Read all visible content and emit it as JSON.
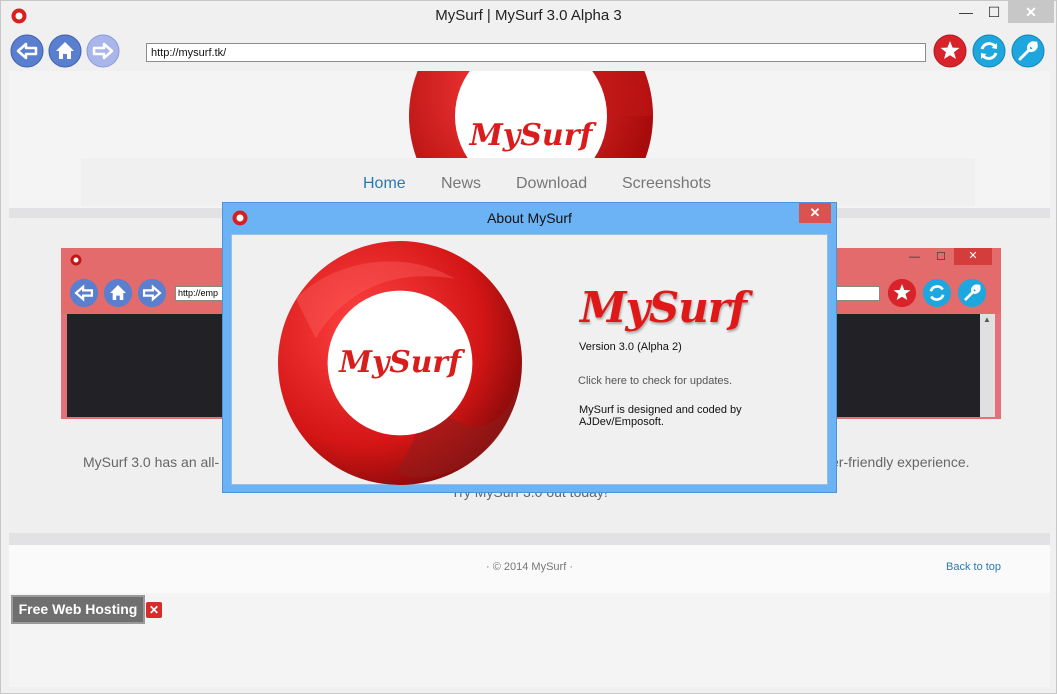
{
  "window": {
    "title": "MySurf | MySurf 3.0 Alpha 3",
    "min_glyph": "—",
    "max_glyph": "☐",
    "close_glyph": "✕"
  },
  "toolbar": {
    "address": "http://mysurf.tk/",
    "icons": [
      "back-arrow-icon",
      "home-icon",
      "forward-arrow-icon",
      "star-icon",
      "refresh-icon",
      "wrench-icon"
    ],
    "colors": {
      "nav_blue": "#5b7fcf",
      "forward_disabled": "#a9b6ea",
      "star_red": "#d8232a",
      "refresh_cyan": "#1ea6de"
    }
  },
  "site": {
    "logo_text": "MySurf",
    "nav": [
      "Home",
      "News",
      "Download",
      "Screenshots"
    ],
    "active_nav": "Home",
    "description_left": "MySurf 3.0 has an all-",
    "description_right": "er-friendly experience.",
    "tagline": "Try MySurf 3.0 out today!",
    "footer_copy": "· © 2014 MySurf ·",
    "back_to_top": "Back to top",
    "screenshot_url": "http://emp",
    "accent": "#2a7ab0"
  },
  "ad": {
    "label": "Free Web Hosting",
    "close_glyph": "✕"
  },
  "dialog": {
    "title": "About MySurf",
    "close_glyph": "✕",
    "brand": "MySurf",
    "logo_text": "MySurf",
    "version": "Version 3.0 (Alpha 2)",
    "update_link": "Click here to check for updates.",
    "credits": "MySurf is designed and coded by AJDev/Emposoft.",
    "brand_color": "#e01818",
    "frame_color": "#6cb3f5"
  }
}
